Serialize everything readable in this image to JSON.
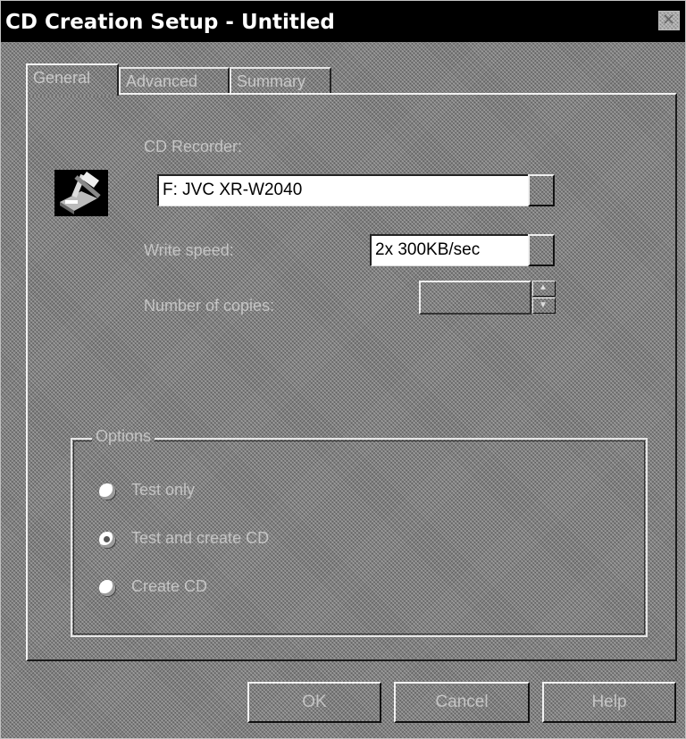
{
  "window": {
    "title": "CD Creation Setup - Untitled",
    "close_glyph": "×"
  },
  "tabs": [
    {
      "label": "General",
      "active": true
    },
    {
      "label": "Advanced",
      "active": false
    },
    {
      "label": "Summary",
      "active": false
    }
  ],
  "general": {
    "icon": "cd-writer-icon",
    "cd_recorder_label": "CD Recorder:",
    "cd_recorder_value": "F: JVC XR-W2040",
    "write_speed_label": "Write speed:",
    "write_speed_value": "2x  300KB/sec",
    "copies_label": "Number of copies:",
    "copies_value": "",
    "options_title": "Options",
    "options": [
      {
        "label": "Test only",
        "checked": false
      },
      {
        "label": "Test and create CD",
        "checked": true
      },
      {
        "label": "Create CD",
        "checked": false
      }
    ]
  },
  "buttons": {
    "ok": "OK",
    "cancel": "Cancel",
    "help": "Help"
  }
}
